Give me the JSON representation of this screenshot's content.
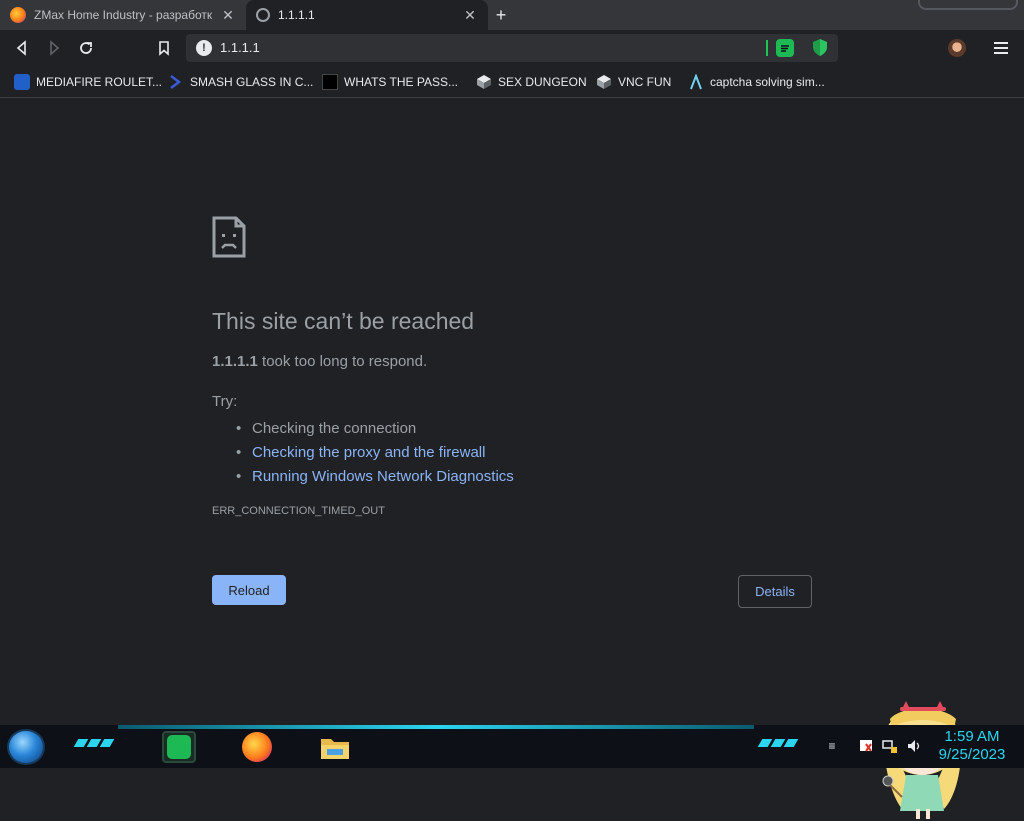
{
  "tabs": [
    {
      "title": "ZMax Home Industry - разработк",
      "favicon": "firefox-icon",
      "active": false
    },
    {
      "title": "1.1.1.1",
      "favicon": "globe-icon",
      "active": true
    }
  ],
  "toolbar": {
    "url": "1.1.1.1",
    "info_glyph": "!"
  },
  "bookmarks": [
    {
      "label": "MEDIAFIRE ROULET...",
      "icon": "mediafire-icon"
    },
    {
      "label": "SMASH GLASS IN C...",
      "icon": "chevron-icon"
    },
    {
      "label": "WHATS THE PASS...",
      "icon": "dark-square-icon"
    },
    {
      "label": "SEX DUNGEON",
      "icon": "cube-icon"
    },
    {
      "label": "VNC FUN",
      "icon": "cube-icon"
    },
    {
      "label": "captcha solving sim...",
      "icon": "lambda-icon"
    }
  ],
  "error": {
    "title": "This site can’t be reached",
    "host": "1.1.1.1",
    "desc_suffix": " took too long to respond.",
    "try_label": "Try:",
    "suggestions": [
      {
        "text": "Checking the connection",
        "link": false
      },
      {
        "text": "Checking the proxy and the firewall",
        "link": true
      },
      {
        "text": "Running Windows Network Diagnostics",
        "link": true
      }
    ],
    "code": "ERR_CONNECTION_TIMED_OUT",
    "reload_label": "Reload",
    "details_label": "Details"
  },
  "taskbar": {
    "time": "1:59 AM",
    "date": "9/25/2023",
    "apps": [
      "spotify-icon",
      "firefox-icon",
      "file-explorer-icon"
    ]
  },
  "colors": {
    "background": "#202124",
    "link": "#8ab4f8",
    "accent_cyan": "#2bd5f0"
  }
}
